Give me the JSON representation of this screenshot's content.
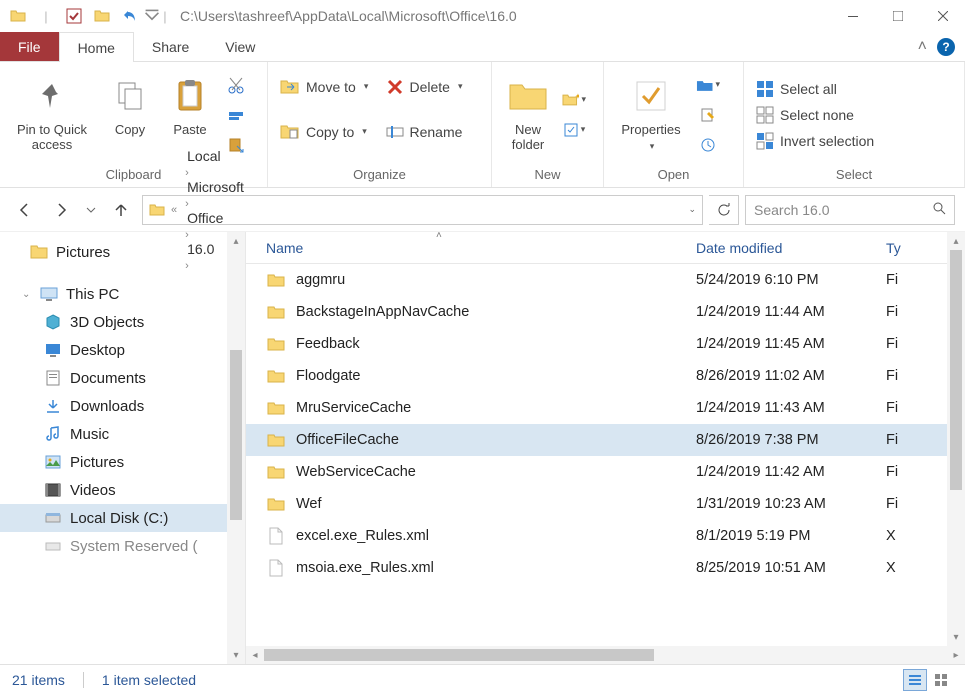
{
  "title_path": "C:\\Users\\tashreef\\AppData\\Local\\Microsoft\\Office\\16.0",
  "tabs": {
    "file": "File",
    "home": "Home",
    "share": "Share",
    "view": "View"
  },
  "ribbon": {
    "clipboard": {
      "label": "Clipboard",
      "pin": "Pin to Quick access",
      "copy": "Copy",
      "paste": "Paste"
    },
    "organize": {
      "label": "Organize",
      "move": "Move to",
      "copy": "Copy to",
      "delete": "Delete",
      "rename": "Rename"
    },
    "new": {
      "label": "New",
      "newfolder": "New folder"
    },
    "open": {
      "label": "Open",
      "properties": "Properties"
    },
    "select": {
      "label": "Select",
      "all": "Select all",
      "none": "Select none",
      "invert": "Invert selection"
    }
  },
  "breadcrumbs": [
    "Local",
    "Microsoft",
    "Office",
    "16.0"
  ],
  "search_placeholder": "Search 16.0",
  "sidebar": {
    "pictures": "Pictures",
    "thispc": "This PC",
    "objects3d": "3D Objects",
    "desktop": "Desktop",
    "documents": "Documents",
    "downloads": "Downloads",
    "music": "Music",
    "pictures2": "Pictures",
    "videos": "Videos",
    "localdisk": "Local Disk (C:)",
    "sysres": "System Reserved ("
  },
  "columns": {
    "name": "Name",
    "date": "Date modified",
    "type": "Ty"
  },
  "rows": [
    {
      "name": "aggmru",
      "date": "5/24/2019 6:10 PM",
      "type": "Fi",
      "kind": "folder"
    },
    {
      "name": "BackstageInAppNavCache",
      "date": "1/24/2019 11:44 AM",
      "type": "Fi",
      "kind": "folder"
    },
    {
      "name": "Feedback",
      "date": "1/24/2019 11:45 AM",
      "type": "Fi",
      "kind": "folder"
    },
    {
      "name": "Floodgate",
      "date": "8/26/2019 11:02 AM",
      "type": "Fi",
      "kind": "folder"
    },
    {
      "name": "MruServiceCache",
      "date": "1/24/2019 11:43 AM",
      "type": "Fi",
      "kind": "folder"
    },
    {
      "name": "OfficeFileCache",
      "date": "8/26/2019 7:38 PM",
      "type": "Fi",
      "kind": "folder",
      "selected": true
    },
    {
      "name": "WebServiceCache",
      "date": "1/24/2019 11:42 AM",
      "type": "Fi",
      "kind": "folder"
    },
    {
      "name": "Wef",
      "date": "1/31/2019 10:23 AM",
      "type": "Fi",
      "kind": "folder"
    },
    {
      "name": "excel.exe_Rules.xml",
      "date": "8/1/2019 5:19 PM",
      "type": "X",
      "kind": "file"
    },
    {
      "name": "msoia.exe_Rules.xml",
      "date": "8/25/2019 10:51 AM",
      "type": "X",
      "kind": "file"
    }
  ],
  "status": {
    "items": "21 items",
    "selected": "1 item selected"
  }
}
